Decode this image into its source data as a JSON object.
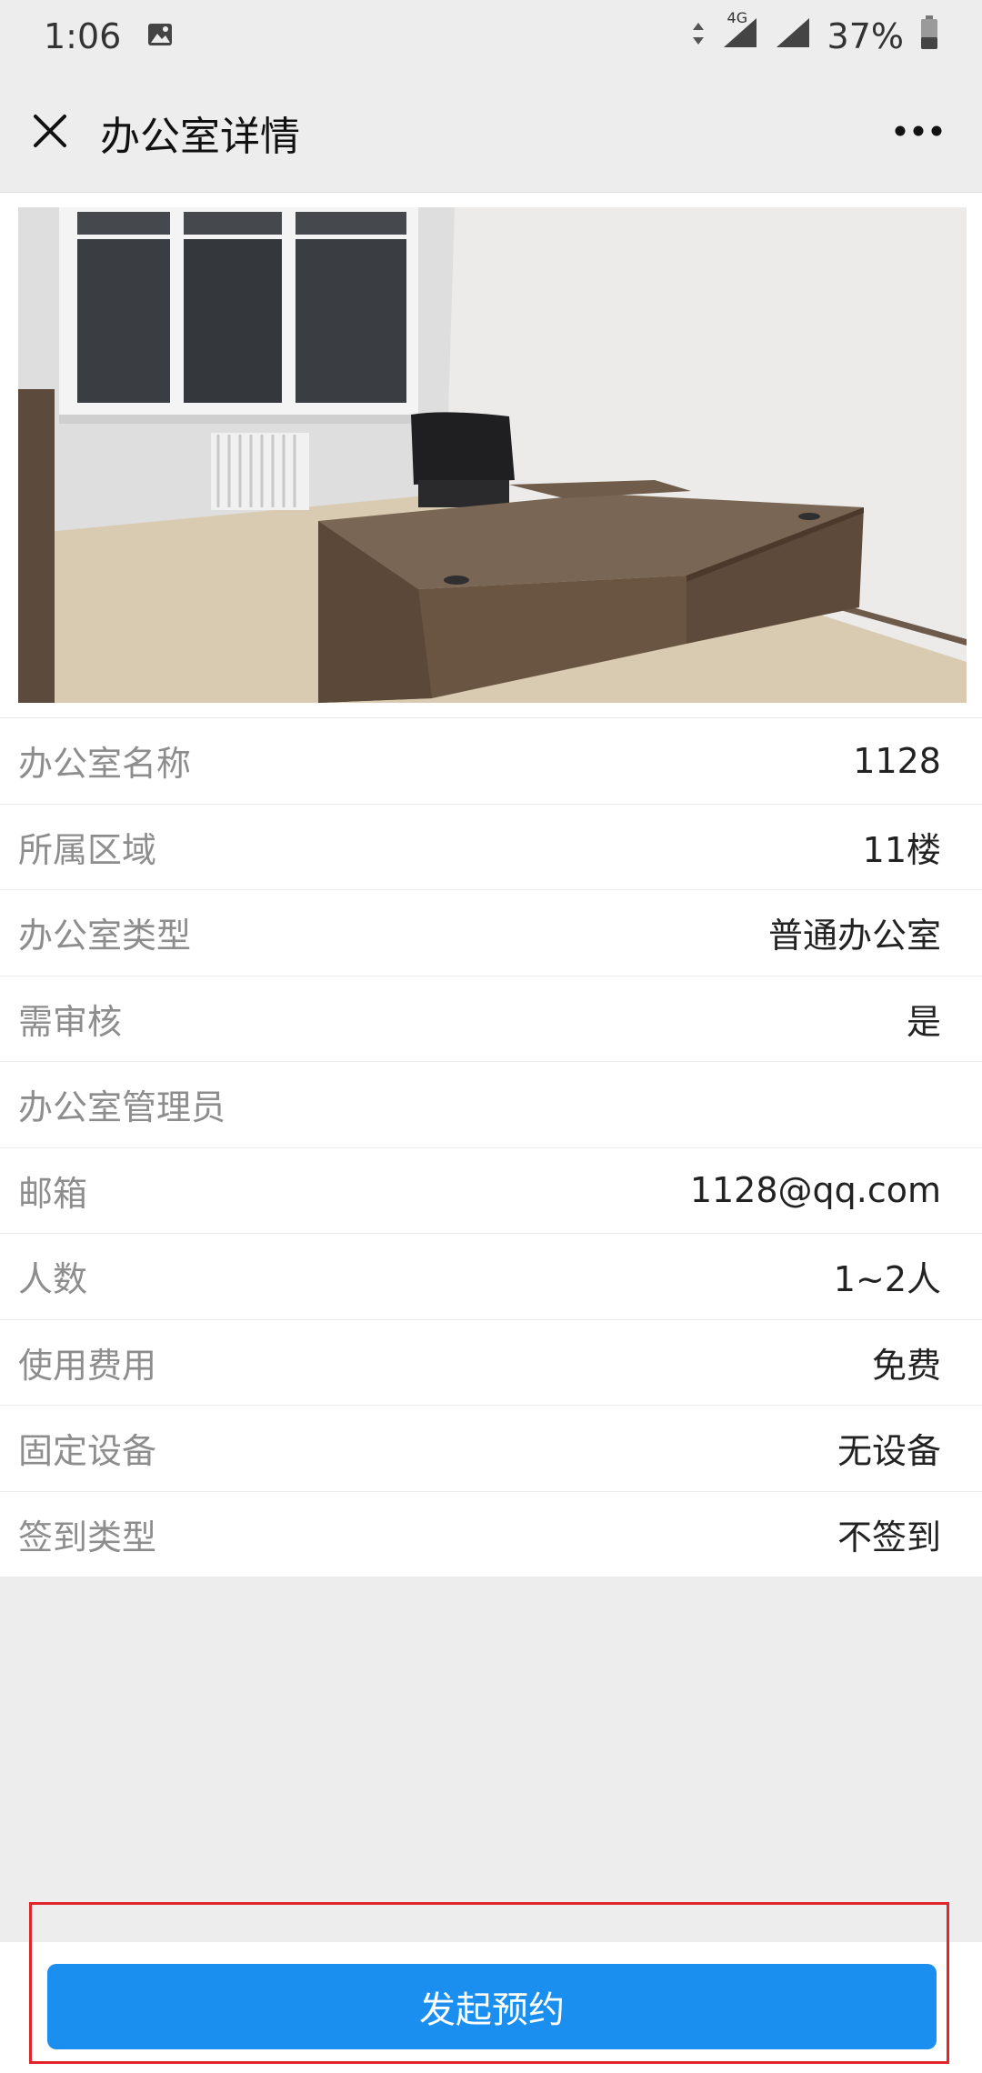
{
  "status_bar": {
    "time": "1:06",
    "network": "4G",
    "battery": "37%"
  },
  "nav": {
    "title": "办公室详情",
    "close_icon": "close-icon",
    "more_icon": "more-horizontal-icon"
  },
  "details": [
    {
      "label": "办公室名称",
      "value": "1128"
    },
    {
      "label": "所属区域",
      "value": "11楼"
    },
    {
      "label": "办公室类型",
      "value": "普通办公室"
    },
    {
      "label": "需审核",
      "value": "是"
    },
    {
      "label": "办公室管理员",
      "value": ""
    },
    {
      "label": "邮箱",
      "value": "1128@qq.com"
    },
    {
      "label": "人数",
      "value": "1~2人"
    },
    {
      "label": "使用费用",
      "value": "免费"
    },
    {
      "label": "固定设备",
      "value": "无设备"
    },
    {
      "label": "签到类型",
      "value": "不签到"
    }
  ],
  "actions": {
    "book_label": "发起预约"
  },
  "colors": {
    "primary": "#1b8ff0",
    "highlight_border": "#e1252a",
    "page_bg": "#ededed"
  }
}
